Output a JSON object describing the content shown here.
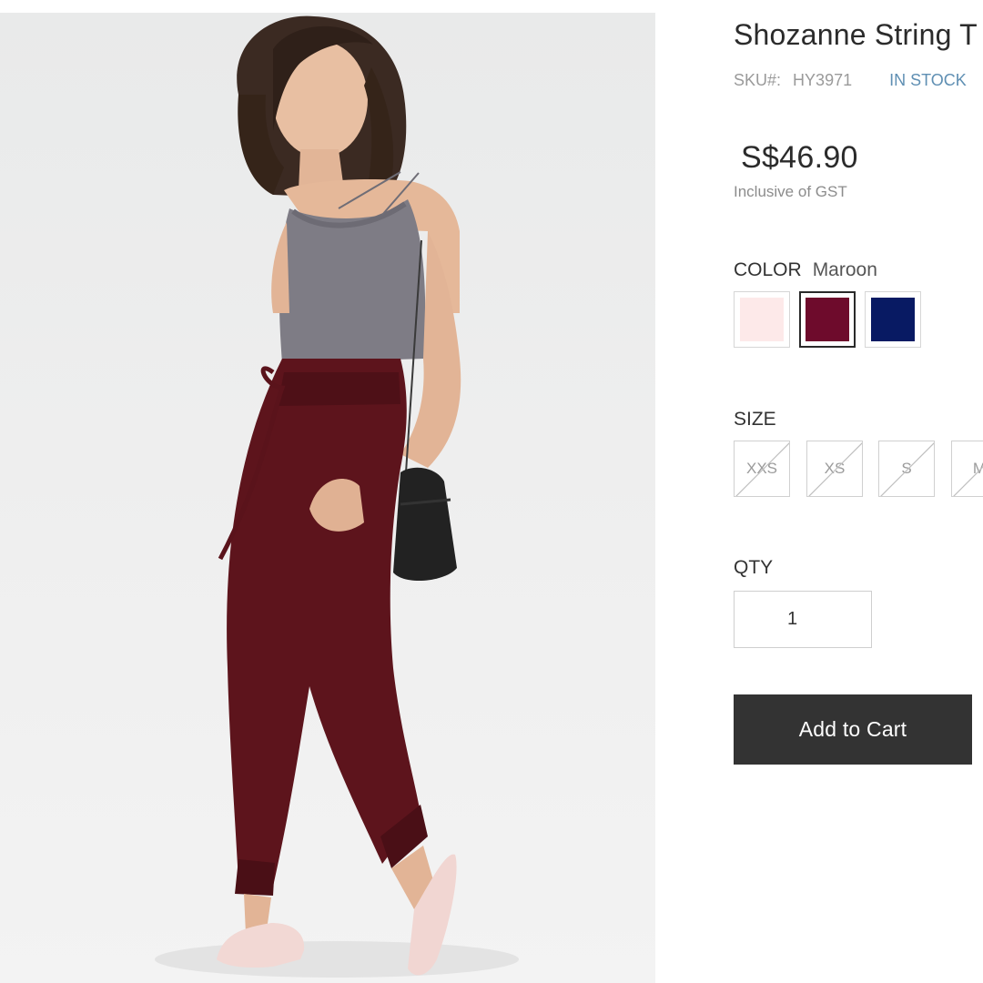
{
  "product": {
    "title": "Shozanne String T",
    "sku_label": "SKU#:",
    "sku": "HY3971",
    "stock_status": "IN STOCK",
    "price": "S$46.90",
    "tax_note": "Inclusive of GST",
    "image_alt_icon": "product-photo"
  },
  "color": {
    "heading": "COLOR",
    "selected": "Maroon",
    "swatches": [
      {
        "name": "Pink",
        "hex": "#fde9e9",
        "selected": false
      },
      {
        "name": "Maroon",
        "hex": "#6e0b2c",
        "selected": true
      },
      {
        "name": "Navy",
        "hex": "#081a63",
        "selected": false
      }
    ]
  },
  "size": {
    "heading": "SIZE",
    "options": [
      {
        "label": "XXS",
        "available": false
      },
      {
        "label": "XS",
        "available": false
      },
      {
        "label": "S",
        "available": false
      },
      {
        "label": "M",
        "available": false
      }
    ]
  },
  "qty": {
    "heading": "QTY",
    "value": "1"
  },
  "cart": {
    "button_label": "Add to Cart",
    "button_color": "#333333"
  }
}
